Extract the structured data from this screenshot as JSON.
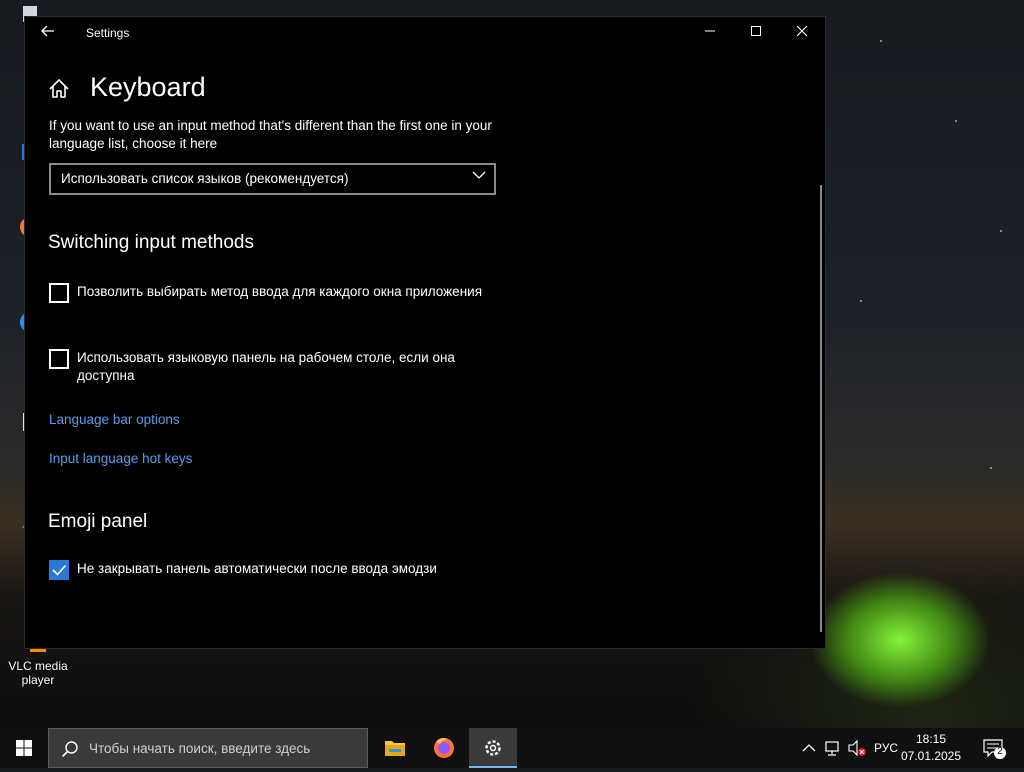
{
  "window": {
    "title": "Settings",
    "page_title": "Keyboard",
    "description": "If you want to use an input method that's different than the first one in your language list, choose it here",
    "input_method_select": {
      "value": "Использовать список языков (рекомендуется)"
    },
    "switching_section": {
      "heading": "Switching input methods",
      "options": [
        {
          "label": "Позволить выбирать метод ввода для каждого окна приложения",
          "checked": false
        },
        {
          "label": "Использовать языковую панель на рабочем столе, если она доступна",
          "checked": false
        }
      ],
      "links": [
        "Language bar options",
        "Input language hot keys"
      ]
    },
    "emoji_section": {
      "heading": "Emoji panel",
      "options": [
        {
          "label": "Не закрывать панель автоматически после ввода эмодзи",
          "checked": true
        }
      ]
    }
  },
  "desktop_icons": [
    {
      "label": "VLC media player",
      "icon": "vlc-icon"
    }
  ],
  "taskbar": {
    "search_placeholder": "Чтобы начать поиск, введите здесь",
    "apps": [
      "file-explorer-icon",
      "firefox-icon",
      "settings-icon"
    ],
    "tray": {
      "language": "РУС",
      "time": "18:15",
      "date": "07.01.2025",
      "notifications_count": "2"
    }
  },
  "colors": {
    "accent": "#2b79d6",
    "link": "#5a9ce8",
    "window_bg": "#000000"
  }
}
